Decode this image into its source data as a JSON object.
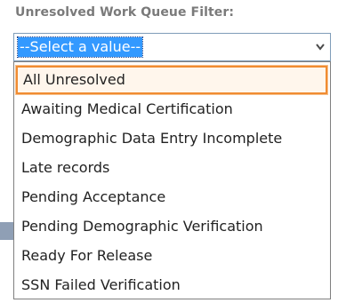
{
  "filter": {
    "label": "Unresolved Work Queue Filter:",
    "selected_value": "--Select a value--",
    "options": [
      {
        "label": "All Unresolved",
        "highlighted": true
      },
      {
        "label": "Awaiting Medical Certification",
        "highlighted": false
      },
      {
        "label": "Demographic Data Entry Incomplete",
        "highlighted": false
      },
      {
        "label": "Late records",
        "highlighted": false
      },
      {
        "label": "Pending Acceptance",
        "highlighted": false
      },
      {
        "label": "Pending Demographic Verification",
        "highlighted": false
      },
      {
        "label": "Ready For Release",
        "highlighted": false
      },
      {
        "label": "SSN Failed Verification",
        "highlighted": false
      }
    ]
  },
  "icons": {
    "dropdown_arrow": "chevron-down-icon"
  },
  "colors": {
    "selection_blue": "#3399ff",
    "highlight_border": "#f08c32",
    "label_gray": "#7a7a7a",
    "select_border": "#7f9db9"
  }
}
